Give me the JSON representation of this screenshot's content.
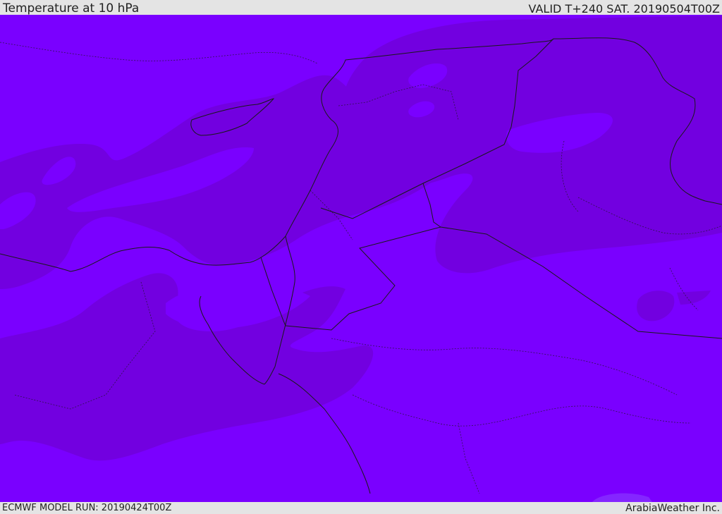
{
  "header": {
    "title": "Temperature at 10 hPa",
    "valid": "VALID T+240 SAT. 20190504T00Z"
  },
  "footer": {
    "model_run": "ECMWF MODEL RUN: 20190424T00Z",
    "brand": "ArabiaWeather Inc."
  },
  "colors": {
    "warm_band": "#7a00ff",
    "cool_band": "#7200e0",
    "cold_spot": "#6c00d0",
    "outline": "#1a1a1a",
    "frame": "#e4e4e4"
  },
  "icons": [
    "map-canvas"
  ]
}
